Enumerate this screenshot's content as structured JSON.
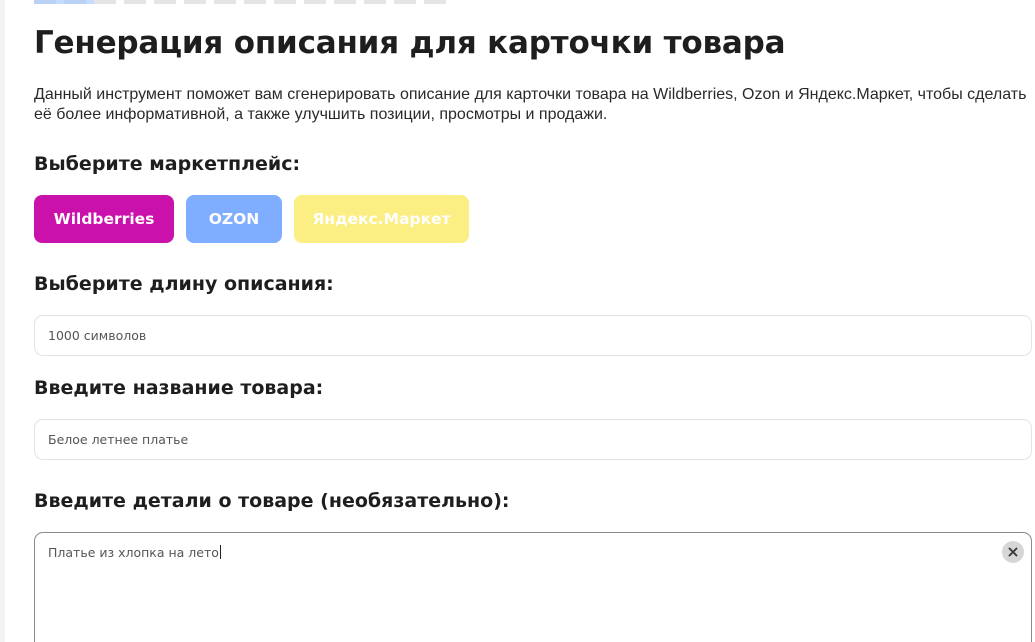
{
  "page": {
    "title": "Генерация описания для карточки товара",
    "intro": "Данный инструмент поможет вам сгенерировать описание для карточки товара на Wildberries, Ozon и Яндекс.Маркет, чтобы сделать её более информативной, а также улучшить позиции, просмотры и продажи."
  },
  "marketplace": {
    "label": "Выберите маркетплейс:",
    "options": [
      {
        "label": "Wildberries",
        "color": "#cb11ab"
      },
      {
        "label": "OZON",
        "color": "#7fadff"
      },
      {
        "label": "Яндекс.Маркет",
        "color": "#fbee82"
      }
    ]
  },
  "length": {
    "label": "Выберите длину описания:",
    "value": "1000 символов"
  },
  "product_name": {
    "label": "Введите название товара:",
    "value": "Белое летнее платье"
  },
  "details": {
    "label": "Введите детали о товаре (необязательно):",
    "value": "Платье из хлопка на лето",
    "clear_icon": "close-icon"
  }
}
